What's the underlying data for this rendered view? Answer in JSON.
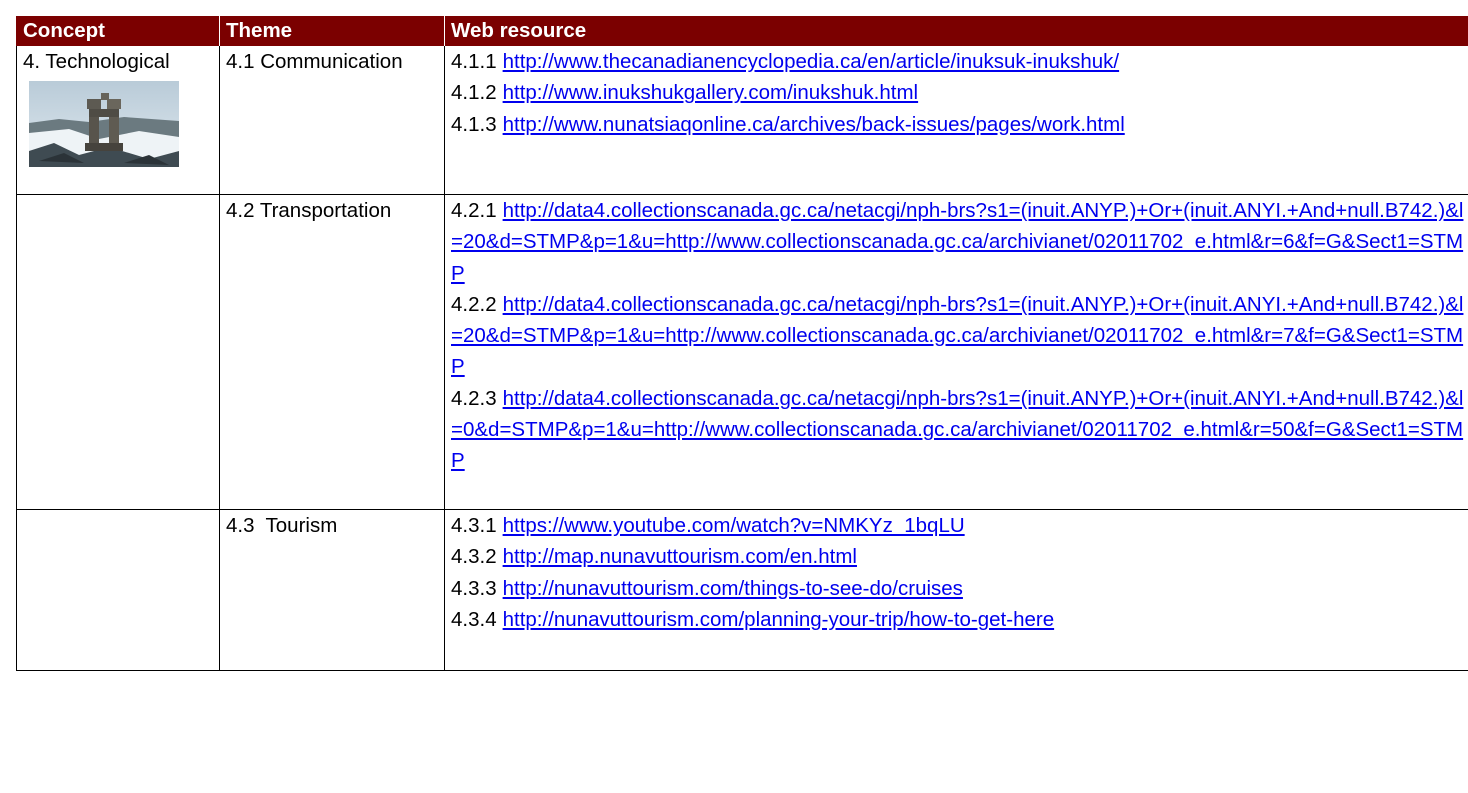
{
  "table": {
    "headers": [
      "Concept",
      "Theme",
      "Web resource"
    ],
    "rows": [
      {
        "concept": "4. Technological",
        "concept_image": "inukshuk-photo",
        "theme": "4.1 Communication",
        "resources": [
          {
            "num": "4.1.1",
            "url": "http://www.thecanadianencyclopedia.ca/en/article/inuksuk-inukshuk/"
          },
          {
            "num": "4.1.2",
            "url": "http://www.inukshukgallery.com/inukshuk.html"
          },
          {
            "num": "4.1.3",
            "url": "http://www.nunatsiaqonline.ca/archives/back-issues/pages/work.html"
          }
        ]
      },
      {
        "concept": "",
        "theme": "4.2 Transportation",
        "resources": [
          {
            "num": "4.2.1",
            "url": "http://data4.collectionscanada.gc.ca/netacgi/nph-brs?s1=(inuit.ANYP.)+Or+(inuit.ANYI.+And+null.B742.)&l=20&d=STMP&p=1&u=http://www.collectionscanada.gc.ca/archivianet/02011702_e.html&r=6&f=G&Sect1=STMP"
          },
          {
            "num": "4.2.2",
            "url": "http://data4.collectionscanada.gc.ca/netacgi/nph-brs?s1=(inuit.ANYP.)+Or+(inuit.ANYI.+And+null.B742.)&l=20&d=STMP&p=1&u=http://www.collectionscanada.gc.ca/archivianet/02011702_e.html&r=7&f=G&Sect1=STMP"
          },
          {
            "num": "4.2.3",
            "url": "http://data4.collectionscanada.gc.ca/netacgi/nph-brs?s1=(inuit.ANYP.)+Or+(inuit.ANYI.+And+null.B742.)&l=0&d=STMP&p=1&u=http://www.collectionscanada.gc.ca/archivianet/02011702_e.html&r=50&f=G&Sect1=STMP"
          }
        ]
      },
      {
        "concept": "",
        "theme": "4.3  Tourism",
        "resources": [
          {
            "num": "4.3.1",
            "url": "https://www.youtube.com/watch?v=NMKYz_1bqLU"
          },
          {
            "num": "4.3.2",
            "url": "http://map.nunavuttourism.com/en.html"
          },
          {
            "num": "4.3.3",
            "url": "http://nunavuttourism.com/things-to-see-do/cruises"
          },
          {
            "num": "4.3.4",
            "url": "http://nunavuttourism.com/planning-your-trip/how-to-get-here"
          }
        ]
      }
    ]
  },
  "colors": {
    "header_bg": "#7b0000",
    "header_text": "#ffffff",
    "link": "#0000ee"
  }
}
